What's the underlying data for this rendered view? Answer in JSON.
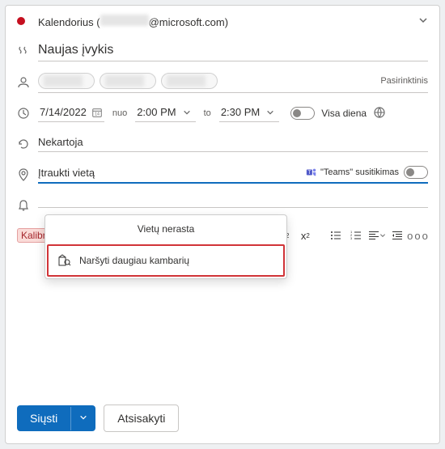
{
  "calendar": {
    "prefix": "Kalendorius (",
    "suffix": "@microsoft.com)"
  },
  "title": {
    "value": "Naujas įvykis"
  },
  "attendees": {
    "optional_label": "Pasirinktinis"
  },
  "date": {
    "value": "7/14/2022",
    "from_label": "nuo",
    "start_time": "2:00 PM",
    "to_label": "to",
    "end_time": "2:30 PM",
    "allday_label": "Visa diena"
  },
  "recurrence": {
    "value": "Nekartoja"
  },
  "location": {
    "placeholder": "Įtraukti vietą",
    "teams_label": "\"Teams\" susitikimas"
  },
  "dropdown": {
    "no_results": "Vietų nerasta",
    "browse_more": "Naršyti daugiau kambarių"
  },
  "toolbar": {
    "font_chip": "Kalibr",
    "superscript": "x",
    "subscript": "x",
    "more": "ooo"
  },
  "footer": {
    "send": "Siųsti",
    "discard": "Atsisakyti"
  }
}
